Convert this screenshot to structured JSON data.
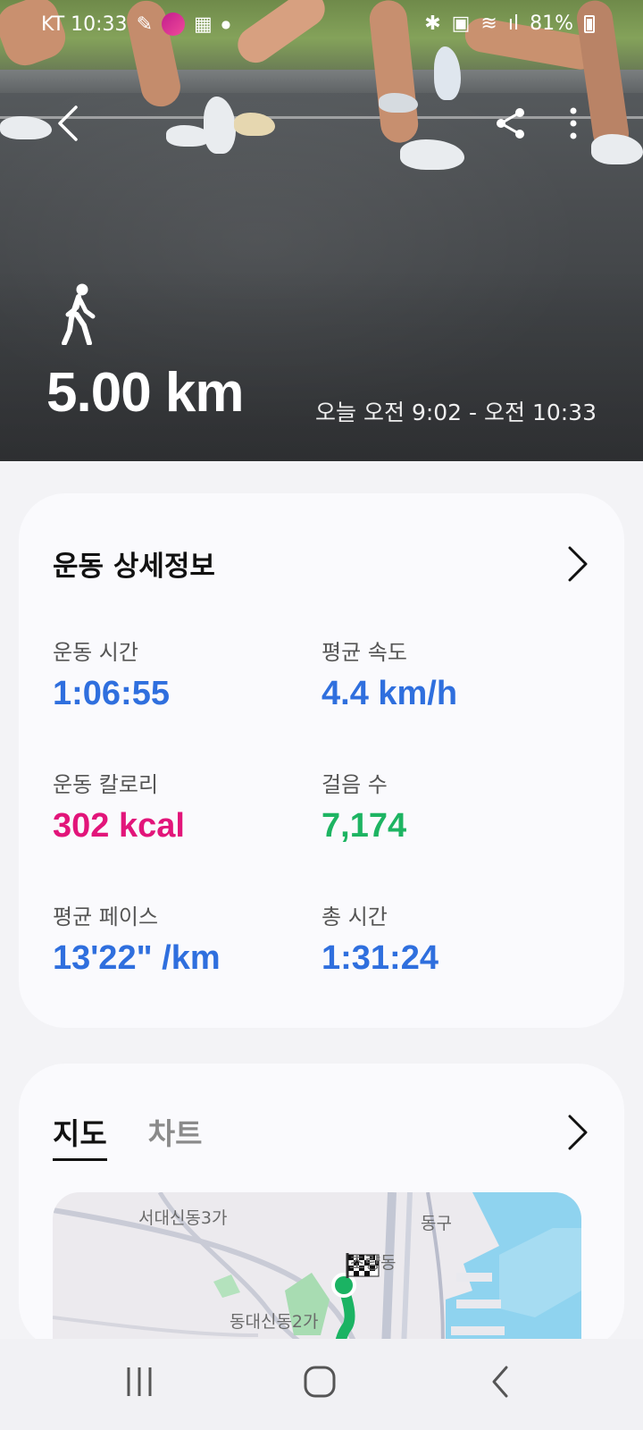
{
  "status_bar": {
    "carrier_time": "KT 10:33",
    "battery": "81%"
  },
  "hero": {
    "activity_icon": "walking-person-icon",
    "distance": "5.00 km",
    "time_range": "오늘 오전 9:02 - 오전 10:33"
  },
  "details": {
    "title": "운동 상세정보",
    "stats": [
      {
        "label": "운동 시간",
        "value": "1:06:55"
      },
      {
        "label": "평균 속도",
        "value": "4.4 km/h"
      },
      {
        "label": "운동 칼로리",
        "value": "302 kcal"
      },
      {
        "label": "걸음 수",
        "value": "7,174"
      },
      {
        "label": "평균 페이스",
        "value": "13'22\" /km"
      },
      {
        "label": "총 시간",
        "value": "1:31:24"
      }
    ],
    "colors": {
      "blue": "#2f6fde",
      "pink": "#e2157a",
      "green": "#1db462"
    }
  },
  "map_card": {
    "tabs": [
      {
        "label": "지도",
        "active": true
      },
      {
        "label": "차트",
        "active": false
      }
    ],
    "map_labels": [
      "서대신동3가",
      "동구",
      "초량동",
      "동대신동2가"
    ]
  },
  "icons": {
    "back": "back-arrow-icon",
    "share": "share-icon",
    "more": "more-vertical-icon",
    "nav_recent": "recent-apps-icon",
    "nav_home": "home-icon",
    "nav_back": "nav-back-icon"
  }
}
